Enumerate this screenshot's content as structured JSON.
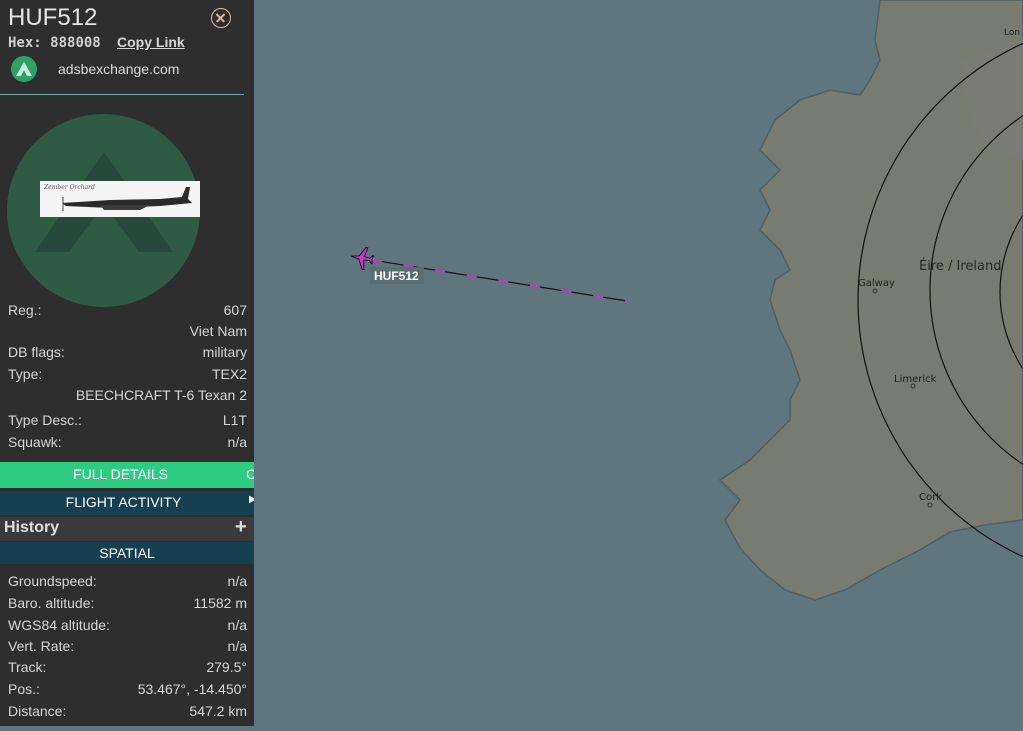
{
  "panel": {
    "callsign": "HUF512",
    "hex_label": "Hex:",
    "hex_value": "888008",
    "copy_link": "Copy Link",
    "site": "adsbexchange.com"
  },
  "details": {
    "reg_label": "Reg.:",
    "reg_value": "607",
    "country": "Viet Nam",
    "dbflags_label": "DB flags:",
    "dbflags_value": "military",
    "type_label": "Type:",
    "type_value": "TEX2",
    "type_full": "BEECHCRAFT T-6 Texan 2",
    "typedesc_label": "Type Desc.:",
    "typedesc_value": "L1T",
    "squawk_label": "Squawk:",
    "squawk_value": "n/a"
  },
  "buttons": {
    "full_details": "FULL DETAILS",
    "full_details_extra": "C",
    "flight_activity": "FLIGHT ACTIVITY"
  },
  "history": {
    "title": "History",
    "toggle": "+"
  },
  "spatial": {
    "title": "SPATIAL",
    "groundspeed_label": "Groundspeed:",
    "groundspeed_value": "n/a",
    "baro_label": "Baro. altitude:",
    "baro_value": "11582 m",
    "wgs_label": "WGS84 altitude:",
    "wgs_value": "n/a",
    "vert_label": "Vert. Rate:",
    "vert_value": "n/a",
    "track_label": "Track:",
    "track_value": "279.5°",
    "pos_label": "Pos.:",
    "pos_value": "53.467°, -14.450°",
    "dist_label": "Distance:",
    "dist_value": "547.2 km"
  },
  "map": {
    "aircraft_label": "HUF512",
    "country_label": "Éire / Ireland",
    "cities": [
      "Galway",
      "Limerick",
      "Cork"
    ],
    "corner_label": "Lon"
  },
  "colors": {
    "sea": "#5f767e",
    "land": "#777b70",
    "aircraft": "#cc33cc",
    "button_green": "#2ecc82",
    "button_navy": "#163f50"
  }
}
